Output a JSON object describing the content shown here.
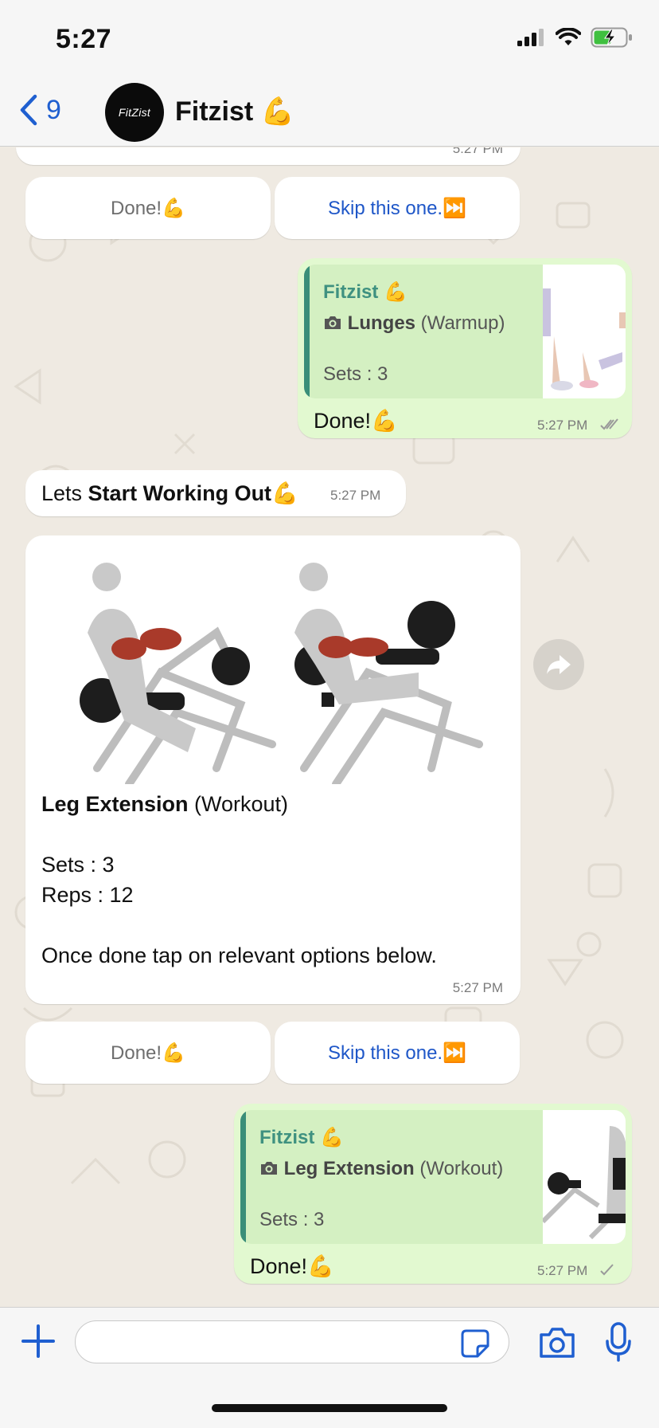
{
  "status_bar": {
    "time": "5:27"
  },
  "nav": {
    "back_count": "9",
    "chat_name": "Fitzist 💪",
    "avatar_text": "FitZist"
  },
  "messages": {
    "top_partial_time": "5:27 PM",
    "reply_row_1": {
      "done": "Done!💪",
      "skip": "Skip this one.⏭️"
    },
    "out_1": {
      "quote_sender": "Fitzist 💪",
      "quote_title": "Lunges",
      "quote_tag": " (Warmup)",
      "quote_sets": "Sets : 3",
      "text": "Done!💪",
      "time": "5:27 PM"
    },
    "in_start": {
      "prefix": "Lets ",
      "bold": "Start Working Out",
      "suffix": "💪",
      "time": "5:27 PM"
    },
    "in_exercise": {
      "title": "Leg Extension",
      "tag": " (Workout)",
      "sets": "Sets : 3",
      "reps": "Reps : 12",
      "instruction": "Once done tap on relevant options below.",
      "time": "5:27 PM"
    },
    "reply_row_2": {
      "done": "Done!💪",
      "skip": "Skip this one.⏭️"
    },
    "out_2": {
      "quote_sender": "Fitzist 💪",
      "quote_title": "Leg Extension",
      "quote_tag": " (Workout)",
      "quote_sets": "Sets : 3",
      "text": "Done!💪",
      "time": "5:27 PM"
    }
  },
  "input": {
    "placeholder": ""
  },
  "icons": {
    "signal": "signal-icon",
    "wifi": "wifi-icon",
    "battery": "battery-charging-icon",
    "back": "chevron-left-icon",
    "forward": "forward-icon",
    "plus": "plus-icon",
    "sticker": "sticker-icon",
    "camera": "camera-icon",
    "mic": "microphone-icon"
  },
  "colors": {
    "accent_blue": "#1f5fd0",
    "outgoing_bubble": "#e2f9d0",
    "quote_bar": "#3a8e79",
    "chat_background": "#efeae2"
  }
}
